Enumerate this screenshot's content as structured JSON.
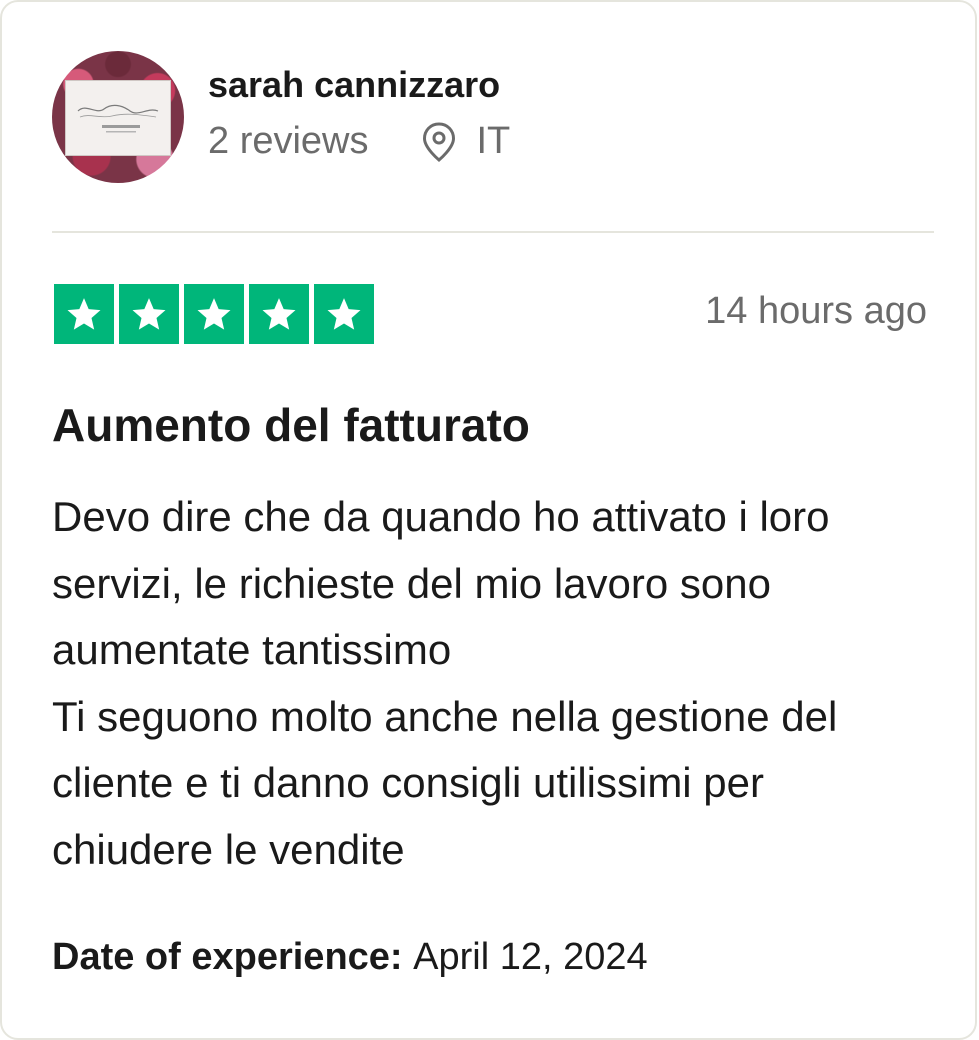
{
  "reviewer": {
    "name": "sarah cannizzaro",
    "reviews_count": "2 reviews",
    "country": "IT",
    "avatar_logo_text": "Sarah Cannizzaro"
  },
  "rating": {
    "stars": 5,
    "max_stars": 5,
    "color": "#00b67a"
  },
  "timestamp": "14 hours ago",
  "review": {
    "title": "Aumento del fatturato",
    "body_lines": [
      "Devo dire che da quando ho attivato i loro servizi, le richieste del mio lavoro sono aumentate tantissimo",
      "Ti seguono molto anche nella gestione del cliente e ti danno consigli utilissimi per chiudere le vendite"
    ]
  },
  "experience": {
    "label": "Date of experience:",
    "date": "April 12, 2024"
  },
  "icons": {
    "location": "location-pin-icon",
    "star": "star-icon"
  }
}
